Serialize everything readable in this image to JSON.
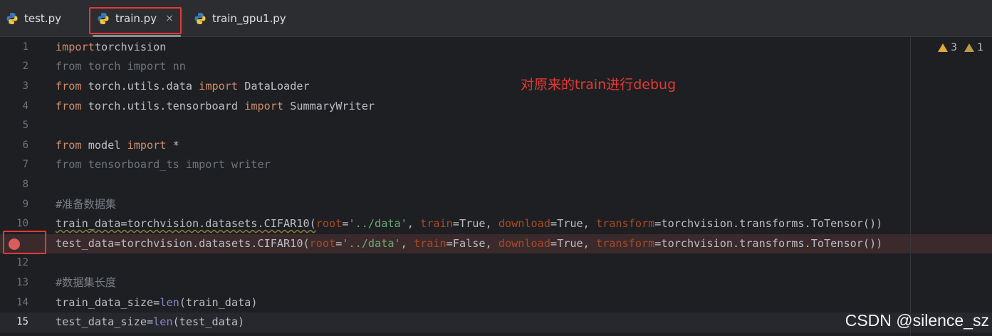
{
  "tabs": [
    {
      "label": "test.py",
      "icon": "python-file-icon",
      "active": false
    },
    {
      "label": "train.py",
      "icon": "python-file-icon",
      "active": true,
      "close": "×"
    },
    {
      "label": "train_gpu1.py",
      "icon": "python-file-icon",
      "active": false
    }
  ],
  "inspections": {
    "warnings": "3",
    "weak_warnings": "1"
  },
  "annotation": "对原来的train进行debug",
  "watermark": "CSDN @silence_sz",
  "colors": {
    "background": "#1e1f22",
    "keyword": "#cf8e6d",
    "string": "#6aab73",
    "param": "#aa4926",
    "builtin": "#8888c6",
    "annotation": "#e53935",
    "breakpoint": "#db5c5c"
  },
  "breakpoint_line": 11,
  "current_line": 15,
  "lines": [
    {
      "n": "1",
      "parts": [
        [
          "kw",
          "import"
        ],
        [
          "",
          "torchvision"
        ]
      ]
    },
    {
      "n": "2",
      "parts": [
        [
          "dim",
          "from torch import nn"
        ]
      ]
    },
    {
      "n": "3",
      "parts": [
        [
          "kw",
          "from"
        ],
        [
          "",
          " torch.utils.data "
        ],
        [
          "kw",
          "import"
        ],
        [
          "",
          " DataLoader"
        ]
      ]
    },
    {
      "n": "4",
      "parts": [
        [
          "kw",
          "from"
        ],
        [
          "",
          " torch.utils.tensorboard "
        ],
        [
          "kw",
          "import"
        ],
        [
          "",
          " SummaryWriter"
        ]
      ]
    },
    {
      "n": "5",
      "parts": []
    },
    {
      "n": "6",
      "parts": [
        [
          "kw",
          "from"
        ],
        [
          "",
          " model "
        ],
        [
          "kw",
          "import"
        ],
        [
          "",
          " *"
        ]
      ]
    },
    {
      "n": "7",
      "parts": [
        [
          "dim",
          "from tensorboard_ts import writer"
        ]
      ]
    },
    {
      "n": "8",
      "parts": []
    },
    {
      "n": "9",
      "parts": [
        [
          "cm",
          "#准备数据集"
        ]
      ]
    },
    {
      "n": "10",
      "parts": [
        [
          "warn",
          "train_data=torchvision.datasets.CIFAR10("
        ],
        [
          "param",
          "root"
        ],
        [
          "",
          "="
        ],
        [
          "str",
          "'../data'"
        ],
        [
          "",
          ", "
        ],
        [
          "param",
          "train"
        ],
        [
          "",
          "=True, "
        ],
        [
          "param",
          "download"
        ],
        [
          "",
          "=True, "
        ],
        [
          "param",
          "transform"
        ],
        [
          "",
          "=torchvision.transforms.ToTensor())"
        ]
      ]
    },
    {
      "n": "11",
      "parts": [
        [
          "",
          "test_data=torchvision.datasets.CIFAR10("
        ],
        [
          "param",
          "root"
        ],
        [
          "",
          "="
        ],
        [
          "str",
          "'../data'"
        ],
        [
          "",
          ", "
        ],
        [
          "param",
          "train"
        ],
        [
          "",
          "=False, "
        ],
        [
          "param",
          "download"
        ],
        [
          "",
          "=True, "
        ],
        [
          "param",
          "transform"
        ],
        [
          "",
          "=torchvision.transforms.ToTensor())"
        ]
      ]
    },
    {
      "n": "12",
      "parts": []
    },
    {
      "n": "13",
      "parts": [
        [
          "cm",
          "#数据集长度"
        ]
      ]
    },
    {
      "n": "14",
      "parts": [
        [
          "",
          "train_data_size="
        ],
        [
          "bi",
          "len"
        ],
        [
          "",
          "(train_data)"
        ]
      ]
    },
    {
      "n": "15",
      "parts": [
        [
          "",
          "test_data_size="
        ],
        [
          "bi",
          "len"
        ],
        [
          "",
          "(test_data)"
        ]
      ]
    }
  ]
}
